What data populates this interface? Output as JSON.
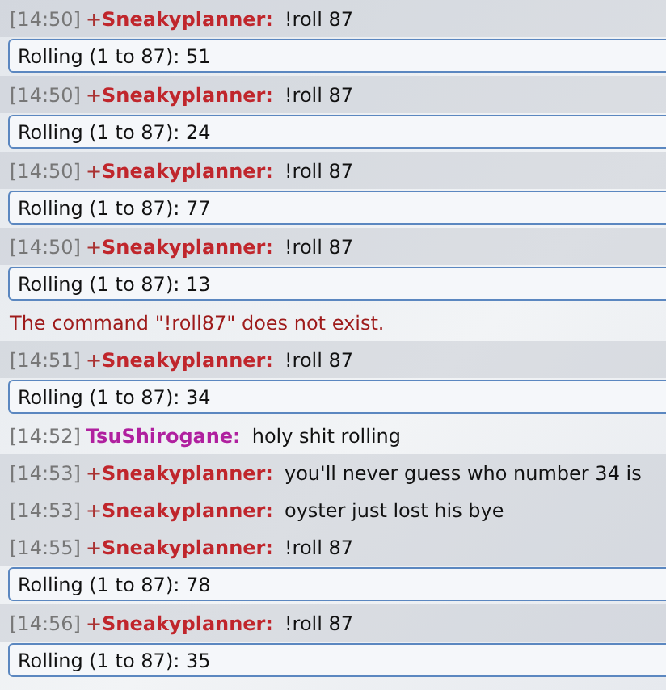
{
  "lines": [
    {
      "kind": "message",
      "time": "[14:50]",
      "rank": "+",
      "user": "Sneakyplanner:",
      "color": "#c0262c",
      "text": "!roll 87"
    },
    {
      "kind": "roll",
      "text": "Rolling (1 to 87): 51"
    },
    {
      "kind": "message",
      "time": "[14:50]",
      "rank": "+",
      "user": "Sneakyplanner:",
      "color": "#c0262c",
      "text": "!roll 87"
    },
    {
      "kind": "roll",
      "text": "Rolling (1 to 87): 24"
    },
    {
      "kind": "message",
      "time": "[14:50]",
      "rank": "+",
      "user": "Sneakyplanner:",
      "color": "#c0262c",
      "text": "!roll 87"
    },
    {
      "kind": "roll",
      "text": "Rolling (1 to 87): 77"
    },
    {
      "kind": "message",
      "time": "[14:50]",
      "rank": "+",
      "user": "Sneakyplanner:",
      "color": "#c0262c",
      "text": "!roll 87"
    },
    {
      "kind": "roll",
      "text": "Rolling (1 to 87): 13"
    },
    {
      "kind": "error",
      "text": "The command \"!roll87\" does not exist."
    },
    {
      "kind": "message",
      "time": "[14:51]",
      "rank": "+",
      "user": "Sneakyplanner:",
      "color": "#c0262c",
      "text": "!roll 87"
    },
    {
      "kind": "roll",
      "text": "Rolling (1 to 87): 34"
    },
    {
      "kind": "message",
      "time": "[14:52]",
      "user": "TsuShirogane:",
      "color": "#b0209f",
      "text": "holy shit rolling"
    },
    {
      "kind": "message",
      "time": "[14:53]",
      "rank": "+",
      "user": "Sneakyplanner:",
      "color": "#c0262c",
      "text": "you'll never guess who number 34 is"
    },
    {
      "kind": "message",
      "time": "[14:53]",
      "rank": "+",
      "user": "Sneakyplanner:",
      "color": "#c0262c",
      "text": "oyster just lost his bye"
    },
    {
      "kind": "message",
      "time": "[14:55]",
      "rank": "+",
      "user": "Sneakyplanner:",
      "color": "#c0262c",
      "text": "!roll 87"
    },
    {
      "kind": "roll",
      "text": "Rolling (1 to 87): 78"
    },
    {
      "kind": "message",
      "time": "[14:56]",
      "rank": "+",
      "user": "Sneakyplanner:",
      "color": "#c0262c",
      "text": "!roll 87"
    },
    {
      "kind": "roll",
      "text": "Rolling (1 to 87): 35"
    }
  ]
}
